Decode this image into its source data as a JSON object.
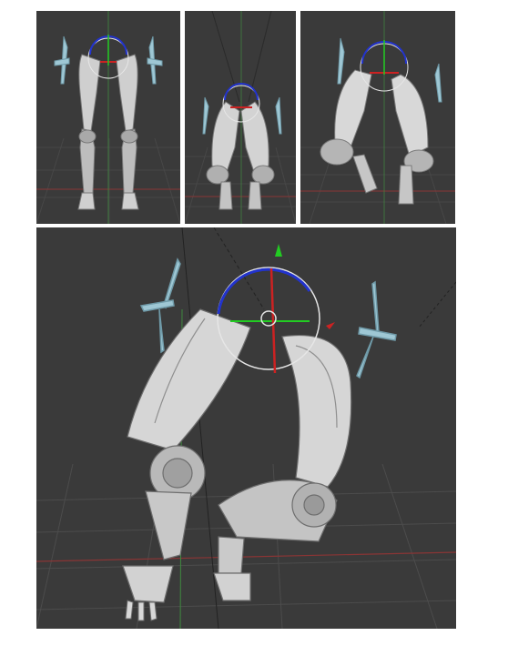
{
  "figure": {
    "panels": [
      {
        "id": "front",
        "label": ""
      },
      {
        "id": "raised",
        "label": ""
      },
      {
        "id": "bent-high",
        "label": ""
      },
      {
        "id": "perspective-closeup",
        "label": ""
      }
    ]
  },
  "colors": {
    "viewport_bg": "#3a3a3a",
    "grid_line": "#4a4a4a",
    "axis_red": "#9a3434",
    "axis_green": "#3f9a3f",
    "mesh_light": "#d7d7d7",
    "mesh_mid": "#b4b4b4",
    "mesh_dark": "#7a7a7a",
    "bone_cyan": "#9ec7d4",
    "gizmo_blue": "#2233cc",
    "gizmo_red": "#cc2222",
    "gizmo_green": "#22cc22",
    "gizmo_white": "#e6e6e6"
  },
  "icons": [
    "rotate-gizmo-icon",
    "bone-control-icon",
    "hand-icon"
  ]
}
